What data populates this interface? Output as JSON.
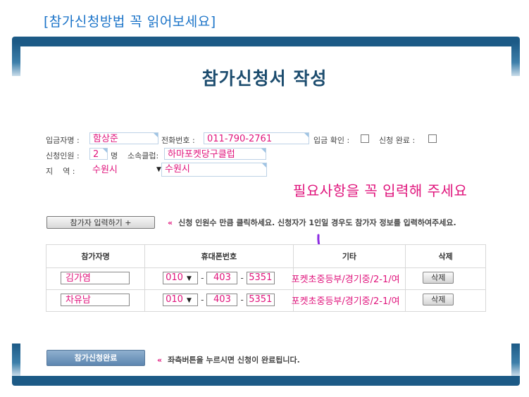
{
  "guide_link": "[참가신청방법 꼭 읽어보세요]",
  "page_title": "참가신청서 작성",
  "form": {
    "depositor_label": "입금자명 :",
    "depositor_value": "함상준",
    "phone_label": "전화번호 :",
    "phone_value": "011-790-2761",
    "deposit_confirm_label": "입금 확인 :",
    "apply_complete_label": "신청 완료 :",
    "headcount_label": "신청인원 :",
    "headcount_value": "2",
    "headcount_unit": "명",
    "club_label": "소속클럽:",
    "club_value": "하마포켓당구클럽",
    "region_label": "지    역 :",
    "region_select": "수원시",
    "region_detail": "수원시"
  },
  "notice_input": "필요사항을 꼭 입력해 주세요",
  "add_button": "참가자 입력하기 +",
  "add_guide": "신청 인원수 만큼 클릭하세요.  신청자가 1인일 경우도 참가자 정보를 입력하여주세요.",
  "guide_marker": "«",
  "table": {
    "headers": [
      "참가자명",
      "휴대폰번호",
      "기타",
      "삭제"
    ],
    "rows": [
      {
        "name": "김가염",
        "phone1": "010",
        "phone2": "403",
        "phone3": "5351",
        "etc": "포켓초중등부/경기중/2-1/여",
        "delete": "삭제"
      },
      {
        "name": "차유남",
        "phone1": "010",
        "phone2": "403",
        "phone3": "5351",
        "etc": "포켓초중등부/경기중/2-1/여",
        "delete": "삭제"
      }
    ],
    "dash": "-"
  },
  "complete_button": "참가신청완료",
  "complete_guide": "좌측버튼을 누르시면 신청이 완료됩니다.",
  "colors": {
    "accent": "#1c5a86",
    "highlight": "#e0147c",
    "link": "#1a73c8"
  }
}
